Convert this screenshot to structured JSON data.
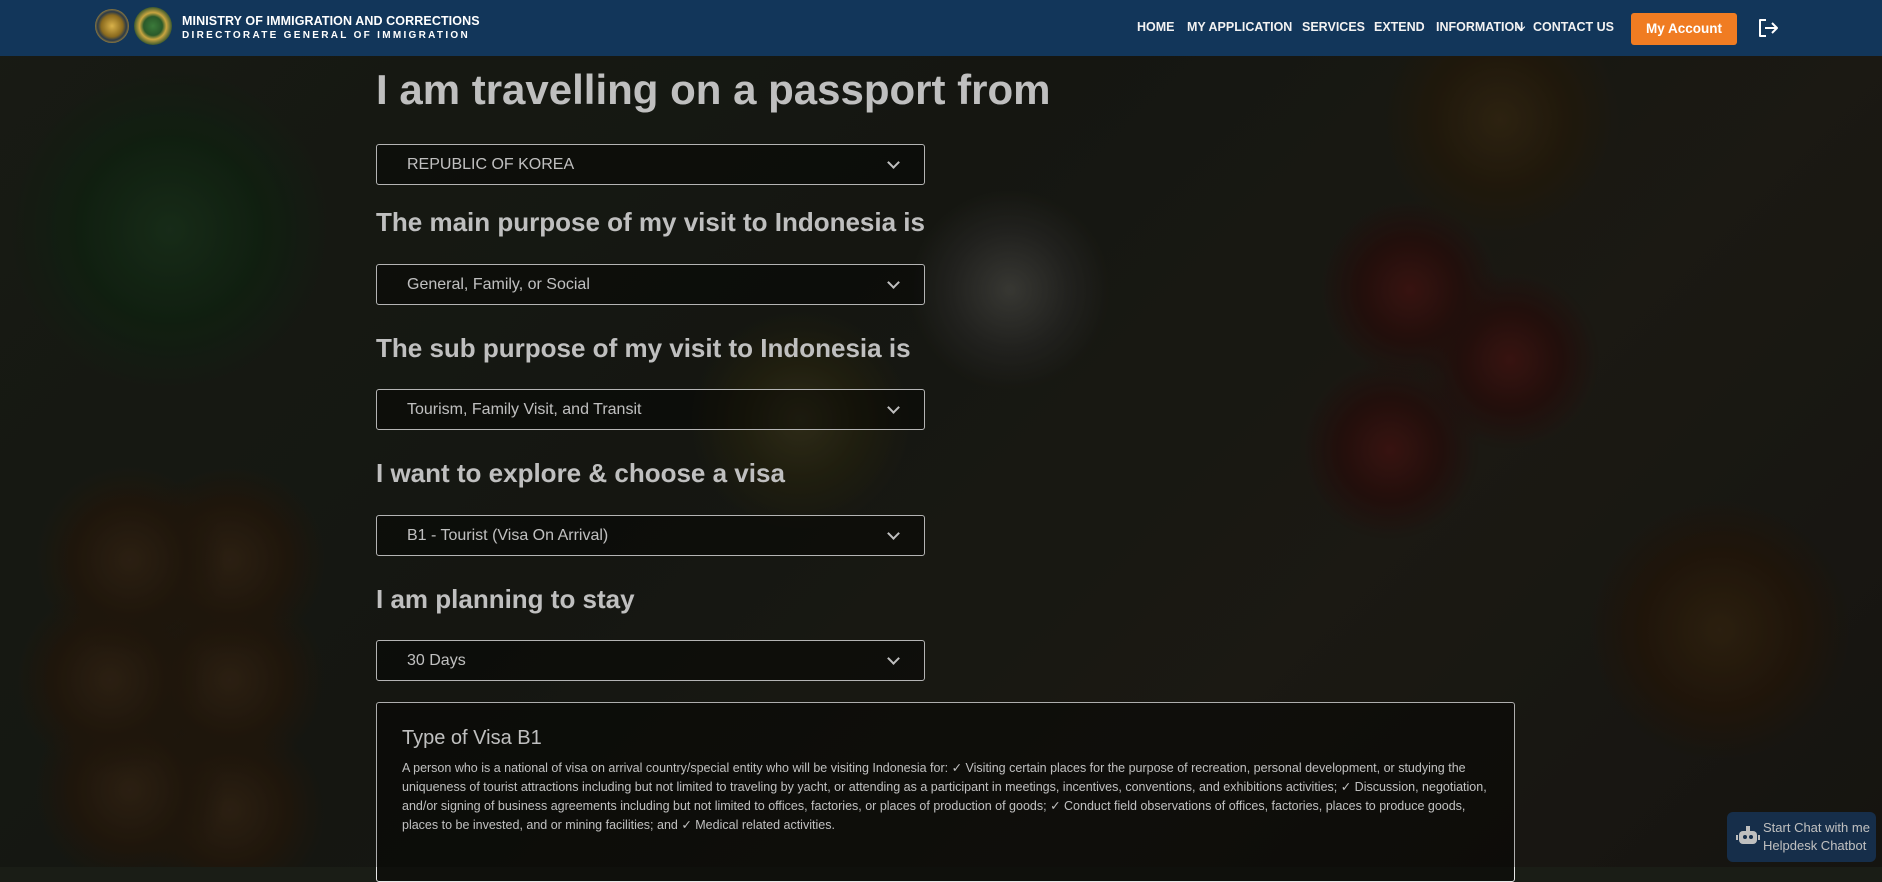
{
  "header": {
    "ministry": "MINISTRY OF IMMIGRATION AND CORRECTIONS",
    "directorate": "DIRECTORATE GENERAL OF IMMIGRATION",
    "logos": [
      "government-emblem",
      "immigration-emblem"
    ],
    "nav": [
      "HOME",
      "MY APPLICATION",
      "SERVICES",
      "EXTEND",
      "INFORMATION",
      "CONTACT US"
    ],
    "account_label": "My Account",
    "logout_icon": "logout-icon"
  },
  "form": {
    "passport_heading": "I am travelling on a passport from",
    "passport_value": "REPUBLIC OF KOREA",
    "purpose_heading": "The main purpose of my visit to Indonesia is",
    "purpose_value": "General, Family, or Social",
    "sub_purpose_heading": "The sub purpose of my visit to Indonesia is",
    "sub_purpose_value": "Tourism, Family Visit, and Transit",
    "visa_heading": "I want to explore & choose a visa",
    "visa_value": "B1 - Tourist (Visa On Arrival)",
    "stay_heading": "I am planning to stay",
    "stay_value": "30 Days"
  },
  "visa_info": {
    "title": "Type of Visa B1",
    "description": "A person who is a national of visa on arrival country/special entity who will be visiting Indonesia for: ✓ Visiting certain places for the purpose of recreation, personal development, or studying the uniqueness of tourist attractions including but not limited to traveling by yacht, or attending as a participant in meetings, incentives, conventions, and exhibitions activities; ✓ Discussion, negotiation, and/or signing of business agreements including but not limited to offices, factories, or places of production of goods; ✓ Conduct field observations of offices, factories, places to produce goods, places to be invested, and or mining facilities; and ✓ Medical related activities."
  },
  "chatbot": {
    "line1": "Start Chat with me",
    "line2": "Helpdesk Chatbot",
    "icon": "robot-icon"
  },
  "colors": {
    "header_bg": "#12365a",
    "accent": "#f07c22",
    "chat_bg": "#1e3e63"
  }
}
